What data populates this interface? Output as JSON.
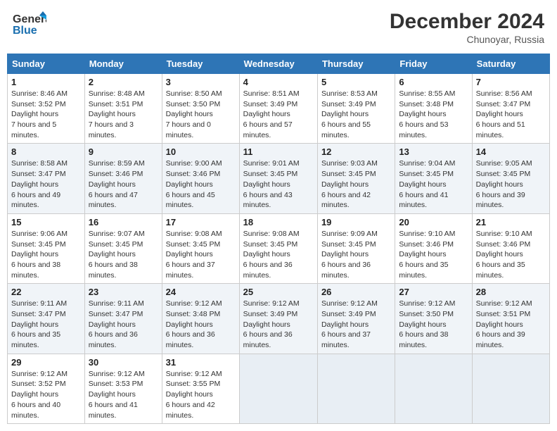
{
  "header": {
    "logo_general": "General",
    "logo_blue": "Blue",
    "title": "December 2024",
    "location": "Chunoyar, Russia"
  },
  "columns": [
    "Sunday",
    "Monday",
    "Tuesday",
    "Wednesday",
    "Thursday",
    "Friday",
    "Saturday"
  ],
  "weeks": [
    [
      {
        "day": "1",
        "sunrise": "8:46 AM",
        "sunset": "3:52 PM",
        "daylight": "7 hours and 5 minutes."
      },
      {
        "day": "2",
        "sunrise": "8:48 AM",
        "sunset": "3:51 PM",
        "daylight": "7 hours and 3 minutes."
      },
      {
        "day": "3",
        "sunrise": "8:50 AM",
        "sunset": "3:50 PM",
        "daylight": "7 hours and 0 minutes."
      },
      {
        "day": "4",
        "sunrise": "8:51 AM",
        "sunset": "3:49 PM",
        "daylight": "6 hours and 57 minutes."
      },
      {
        "day": "5",
        "sunrise": "8:53 AM",
        "sunset": "3:49 PM",
        "daylight": "6 hours and 55 minutes."
      },
      {
        "day": "6",
        "sunrise": "8:55 AM",
        "sunset": "3:48 PM",
        "daylight": "6 hours and 53 minutes."
      },
      {
        "day": "7",
        "sunrise": "8:56 AM",
        "sunset": "3:47 PM",
        "daylight": "6 hours and 51 minutes."
      }
    ],
    [
      {
        "day": "8",
        "sunrise": "8:58 AM",
        "sunset": "3:47 PM",
        "daylight": "6 hours and 49 minutes."
      },
      {
        "day": "9",
        "sunrise": "8:59 AM",
        "sunset": "3:46 PM",
        "daylight": "6 hours and 47 minutes."
      },
      {
        "day": "10",
        "sunrise": "9:00 AM",
        "sunset": "3:46 PM",
        "daylight": "6 hours and 45 minutes."
      },
      {
        "day": "11",
        "sunrise": "9:01 AM",
        "sunset": "3:45 PM",
        "daylight": "6 hours and 43 minutes."
      },
      {
        "day": "12",
        "sunrise": "9:03 AM",
        "sunset": "3:45 PM",
        "daylight": "6 hours and 42 minutes."
      },
      {
        "day": "13",
        "sunrise": "9:04 AM",
        "sunset": "3:45 PM",
        "daylight": "6 hours and 41 minutes."
      },
      {
        "day": "14",
        "sunrise": "9:05 AM",
        "sunset": "3:45 PM",
        "daylight": "6 hours and 39 minutes."
      }
    ],
    [
      {
        "day": "15",
        "sunrise": "9:06 AM",
        "sunset": "3:45 PM",
        "daylight": "6 hours and 38 minutes."
      },
      {
        "day": "16",
        "sunrise": "9:07 AM",
        "sunset": "3:45 PM",
        "daylight": "6 hours and 38 minutes."
      },
      {
        "day": "17",
        "sunrise": "9:08 AM",
        "sunset": "3:45 PM",
        "daylight": "6 hours and 37 minutes."
      },
      {
        "day": "18",
        "sunrise": "9:08 AM",
        "sunset": "3:45 PM",
        "daylight": "6 hours and 36 minutes."
      },
      {
        "day": "19",
        "sunrise": "9:09 AM",
        "sunset": "3:45 PM",
        "daylight": "6 hours and 36 minutes."
      },
      {
        "day": "20",
        "sunrise": "9:10 AM",
        "sunset": "3:46 PM",
        "daylight": "6 hours and 35 minutes."
      },
      {
        "day": "21",
        "sunrise": "9:10 AM",
        "sunset": "3:46 PM",
        "daylight": "6 hours and 35 minutes."
      }
    ],
    [
      {
        "day": "22",
        "sunrise": "9:11 AM",
        "sunset": "3:47 PM",
        "daylight": "6 hours and 35 minutes."
      },
      {
        "day": "23",
        "sunrise": "9:11 AM",
        "sunset": "3:47 PM",
        "daylight": "6 hours and 36 minutes."
      },
      {
        "day": "24",
        "sunrise": "9:12 AM",
        "sunset": "3:48 PM",
        "daylight": "6 hours and 36 minutes."
      },
      {
        "day": "25",
        "sunrise": "9:12 AM",
        "sunset": "3:49 PM",
        "daylight": "6 hours and 36 minutes."
      },
      {
        "day": "26",
        "sunrise": "9:12 AM",
        "sunset": "3:49 PM",
        "daylight": "6 hours and 37 minutes."
      },
      {
        "day": "27",
        "sunrise": "9:12 AM",
        "sunset": "3:50 PM",
        "daylight": "6 hours and 38 minutes."
      },
      {
        "day": "28",
        "sunrise": "9:12 AM",
        "sunset": "3:51 PM",
        "daylight": "6 hours and 39 minutes."
      }
    ],
    [
      {
        "day": "29",
        "sunrise": "9:12 AM",
        "sunset": "3:52 PM",
        "daylight": "6 hours and 40 minutes."
      },
      {
        "day": "30",
        "sunrise": "9:12 AM",
        "sunset": "3:53 PM",
        "daylight": "6 hours and 41 minutes."
      },
      {
        "day": "31",
        "sunrise": "9:12 AM",
        "sunset": "3:55 PM",
        "daylight": "6 hours and 42 minutes."
      },
      null,
      null,
      null,
      null
    ]
  ]
}
